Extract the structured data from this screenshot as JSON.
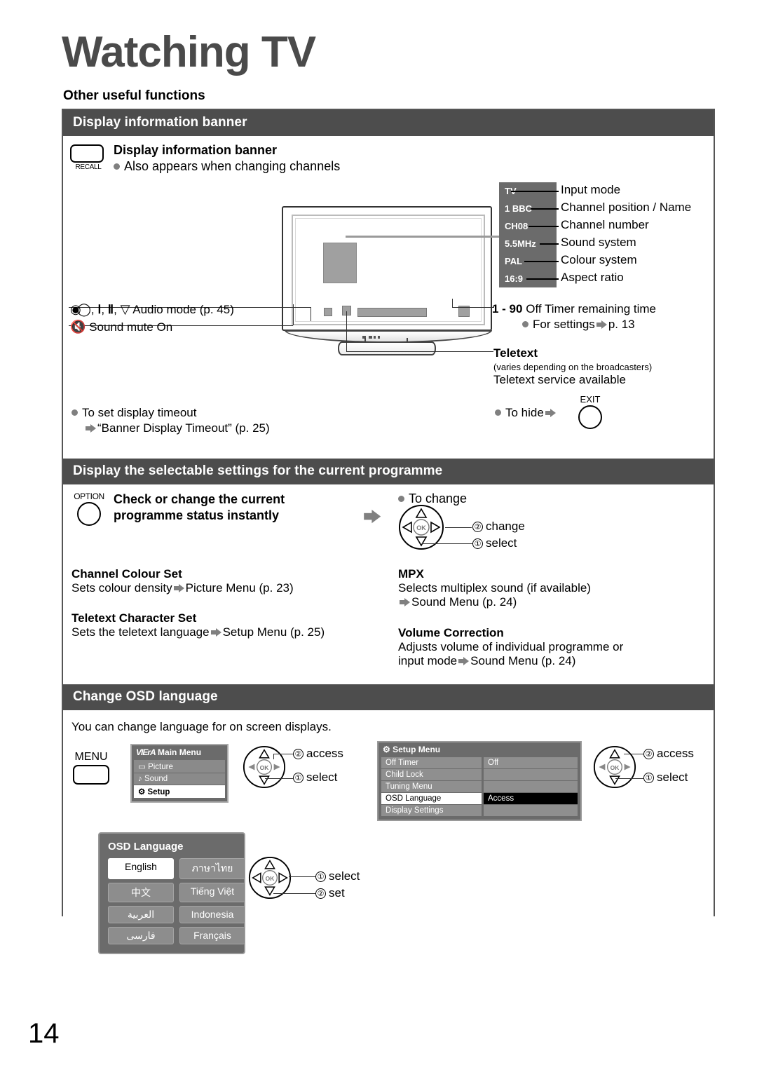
{
  "page": {
    "title": "Watching TV",
    "subtitle": "Other useful functions",
    "page_number": "14"
  },
  "section1": {
    "header": "Display information banner",
    "recall_key": "RECALL",
    "heading": "Display information banner",
    "note": "Also appears when changing channels",
    "banner_rows": [
      {
        "value": "TV",
        "label": "Input mode"
      },
      {
        "value": "1 BBC",
        "label": "Channel position / Name"
      },
      {
        "value": "CH08",
        "label": "Channel number"
      },
      {
        "value": "5.5MHz",
        "label": "Sound system"
      },
      {
        "value": "PAL",
        "label": "Colour system"
      },
      {
        "value": "16:9",
        "label": "Aspect ratio"
      }
    ],
    "off_timer_range": "1 - 90",
    "off_timer_text": "Off Timer remaining time",
    "off_timer_settings": "For settings",
    "off_timer_page": "p. 13",
    "teletext_title": "Teletext",
    "teletext_note": "(varies depending on the broadcasters)",
    "teletext_avail": "Teletext service available",
    "audio_mode": "Audio mode (p. 45)",
    "sound_mute": "Sound mute On",
    "timeout_line1": "To set display timeout",
    "timeout_line2": "“Banner Display Timeout” (p. 25)",
    "to_hide": "To hide",
    "exit_key": "EXIT"
  },
  "section2": {
    "header": "Display the selectable settings for the current programme",
    "option_key": "OPTION",
    "heading_line1": "Check or change the current",
    "heading_line2": "programme status instantly",
    "to_change": "To change",
    "dpad_step2": "change",
    "dpad_step1": "select",
    "num1": "①",
    "num2": "②",
    "ok_label": "OK",
    "items": [
      {
        "title": "Channel Colour Set",
        "desc_pre": "Sets colour density",
        "desc_post": "Picture Menu (p. 23)"
      },
      {
        "title": "Teletext Character Set",
        "desc_pre": "Sets the teletext language",
        "desc_post": "Setup Menu (p. 25)"
      }
    ],
    "items_right": [
      {
        "title": "MPX",
        "line1": "Selects multiplex sound (if available)",
        "line2_post": "Sound Menu (p. 24)"
      },
      {
        "title": "Volume Correction",
        "line1": "Adjusts volume of individual programme or",
        "line2_pre": "input mode",
        "line2_post": "Sound Menu (p. 24)"
      }
    ]
  },
  "section3": {
    "header": "Change OSD language",
    "intro": "You can change language for on screen displays.",
    "menu_key": "MENU",
    "main_menu": {
      "brand": "VIErA",
      "title": "Main Menu",
      "items": [
        {
          "icon": "picture-icon",
          "label": "Picture",
          "selected": false
        },
        {
          "icon": "sound-icon",
          "label": "Sound",
          "selected": false
        },
        {
          "icon": "setup-icon",
          "label": "Setup",
          "selected": true
        }
      ]
    },
    "dpad1": {
      "step2": "access",
      "step1": "select"
    },
    "setup_menu": {
      "title": "Setup Menu",
      "rows": [
        {
          "name": "Off Timer",
          "value": "Off",
          "selected": false
        },
        {
          "name": "Child Lock",
          "value": "",
          "selected": false
        },
        {
          "name": "Tuning Menu",
          "value": "",
          "selected": false
        },
        {
          "name": "OSD Language",
          "value": "Access",
          "selected": true
        },
        {
          "name": "Display Settings",
          "value": "",
          "selected": false
        }
      ]
    },
    "dpad2": {
      "step2": "access",
      "step1": "select"
    },
    "osd_language": {
      "title": "OSD Language",
      "options": [
        {
          "label": "English",
          "selected": true
        },
        {
          "label": "ภาษาไทย",
          "selected": false
        },
        {
          "label": "中文",
          "selected": false
        },
        {
          "label": "Tiếng Việt",
          "selected": false
        },
        {
          "label": "العربية",
          "selected": false
        },
        {
          "label": "Indonesia",
          "selected": false
        },
        {
          "label": "فارسی",
          "selected": false
        },
        {
          "label": "Français",
          "selected": false
        }
      ]
    },
    "dpad3": {
      "step1": "select",
      "step2": "set"
    }
  },
  "colors": {
    "header_bg": "#4d4d4d",
    "title_grey": "#4a4a4a",
    "osd_bg": "#6b6b6b",
    "bullet_grey": "#808080"
  }
}
